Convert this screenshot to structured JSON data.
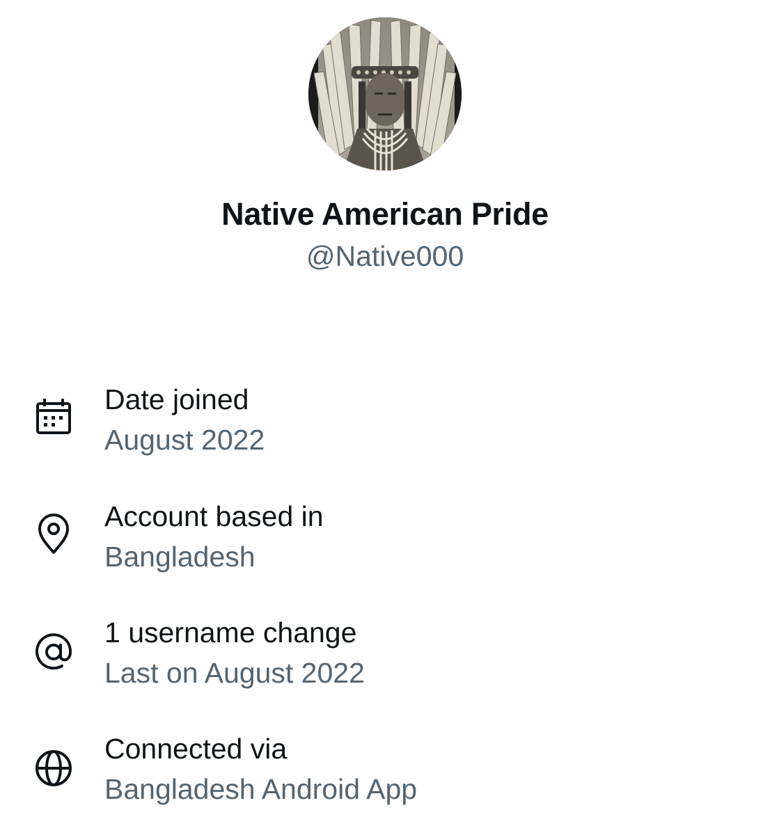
{
  "profile": {
    "display_name": "Native American Pride",
    "handle": "@Native000",
    "avatar_icon": "profile-photo"
  },
  "info": {
    "date_joined": {
      "icon": "calendar-icon",
      "label": "Date joined",
      "value": "August 2022"
    },
    "account_based_in": {
      "icon": "location-pin-icon",
      "label": "Account based in",
      "value": "Bangladesh"
    },
    "username_changes": {
      "icon": "at-sign-icon",
      "label": "1 username change",
      "value": "Last on August 2022"
    },
    "connected_via": {
      "icon": "globe-icon",
      "label": "Connected via",
      "value": "Bangladesh Android App"
    }
  },
  "colors": {
    "primary_text": "#0f1419",
    "secondary_text": "#536471",
    "background": "#ffffff"
  }
}
